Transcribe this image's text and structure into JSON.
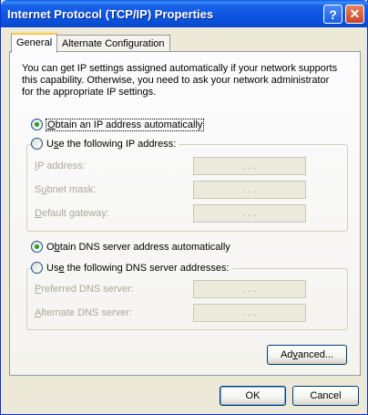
{
  "window": {
    "title": "Internet Protocol (TCP/IP) Properties",
    "help_glyph": "?",
    "close_glyph": "✕"
  },
  "tabs": [
    {
      "label": "General",
      "selected": true
    },
    {
      "label": "Alternate Configuration",
      "selected": false
    }
  ],
  "description": "You can get IP settings assigned automatically if your network supports this capability. Otherwise, you need to ask your network administrator for the appropriate IP settings.",
  "ip": {
    "auto_option": {
      "mn": "O",
      "rest": "btain an IP address automatically",
      "checked": true
    },
    "manual_option": {
      "pre": "U",
      "mn": "s",
      "rest": "e the following IP address:",
      "checked": false
    },
    "fields": [
      {
        "pre": "",
        "mn": "I",
        "rest": "P address:",
        "value": ". . ."
      },
      {
        "pre": "S",
        "mn": "u",
        "rest": "bnet mask:",
        "value": ". . ."
      },
      {
        "pre": "",
        "mn": "D",
        "rest": "efault gateway:",
        "value": ". . ."
      }
    ]
  },
  "dns": {
    "auto_option": {
      "pre": "O",
      "mn": "b",
      "rest": "tain DNS server address automatically",
      "checked": true
    },
    "manual_option": {
      "pre": "Us",
      "mn": "e",
      "rest": " the following DNS server addresses:",
      "checked": false
    },
    "fields": [
      {
        "pre": "",
        "mn": "P",
        "rest": "referred DNS server:",
        "value": ". . ."
      },
      {
        "pre": "",
        "mn": "A",
        "rest": "lternate DNS server:",
        "value": ". . ."
      }
    ]
  },
  "buttons": {
    "advanced": {
      "pre": "Ad",
      "mn": "v",
      "rest": "anced..."
    },
    "ok": "OK",
    "cancel": "Cancel"
  }
}
